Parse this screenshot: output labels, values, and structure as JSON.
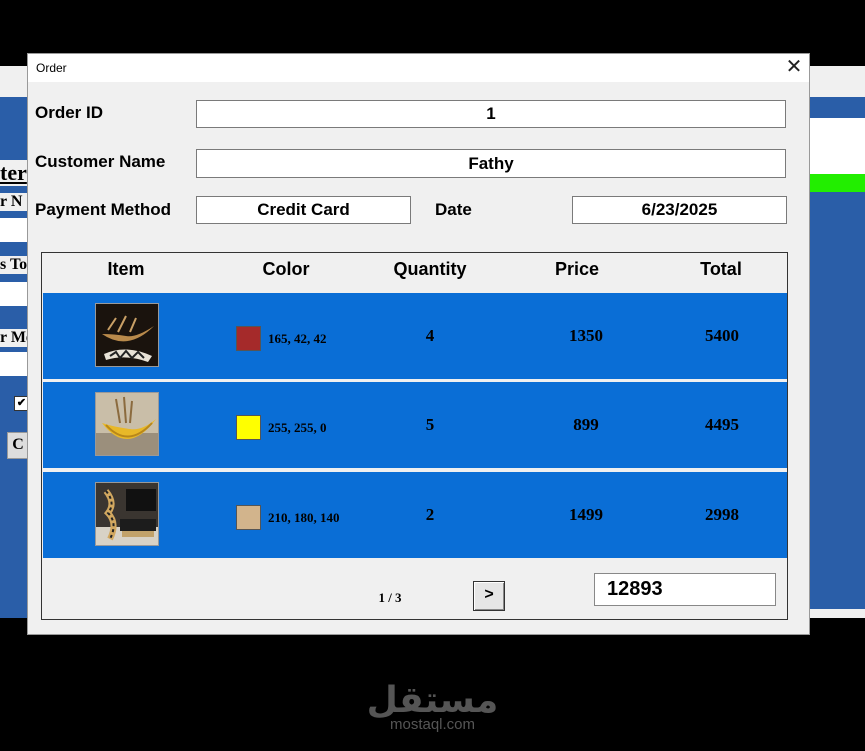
{
  "background_window": {
    "fragments": [
      "ter",
      "r N",
      "s To",
      "r Me",
      "C"
    ]
  },
  "dialog": {
    "title": "Order",
    "close_symbol": "✕",
    "order_id_label": "Order ID",
    "order_id_value": "1",
    "customer_label": "Customer Name",
    "customer_value": "Fathy",
    "payment_label": "Payment Method",
    "payment_value": "Credit Card",
    "date_label": "Date",
    "date_value": "6/23/2025"
  },
  "table": {
    "columns": [
      "Item",
      "Color",
      "Quantity",
      "Price",
      "Total"
    ],
    "rows": [
      {
        "item_image": "bowl-dark-image",
        "color_hex": "#a52a2a",
        "color_rgb": "165, 42, 42",
        "quantity": "4",
        "price": "1350",
        "total": "5400"
      },
      {
        "item_image": "bowl-yellow-image",
        "color_hex": "#ffff00",
        "color_rgb": "255, 255, 0",
        "quantity": "5",
        "price": "899",
        "total": "4495"
      },
      {
        "item_image": "sculpture-image",
        "color_hex": "#d2b48c",
        "color_rgb": "210, 180, 140",
        "quantity": "2",
        "price": "1499",
        "total": "2998"
      }
    ]
  },
  "footer": {
    "page_indicator": "1 / 3",
    "next_label": ">",
    "grand_total": "12893"
  },
  "watermark": {
    "arabic": "مستقل",
    "latin": "mostaql.com"
  },
  "colors": {
    "row_blue": "#0a6ed6",
    "bg_blue": "#2a5ea8",
    "bg_green": "#22ee00"
  }
}
